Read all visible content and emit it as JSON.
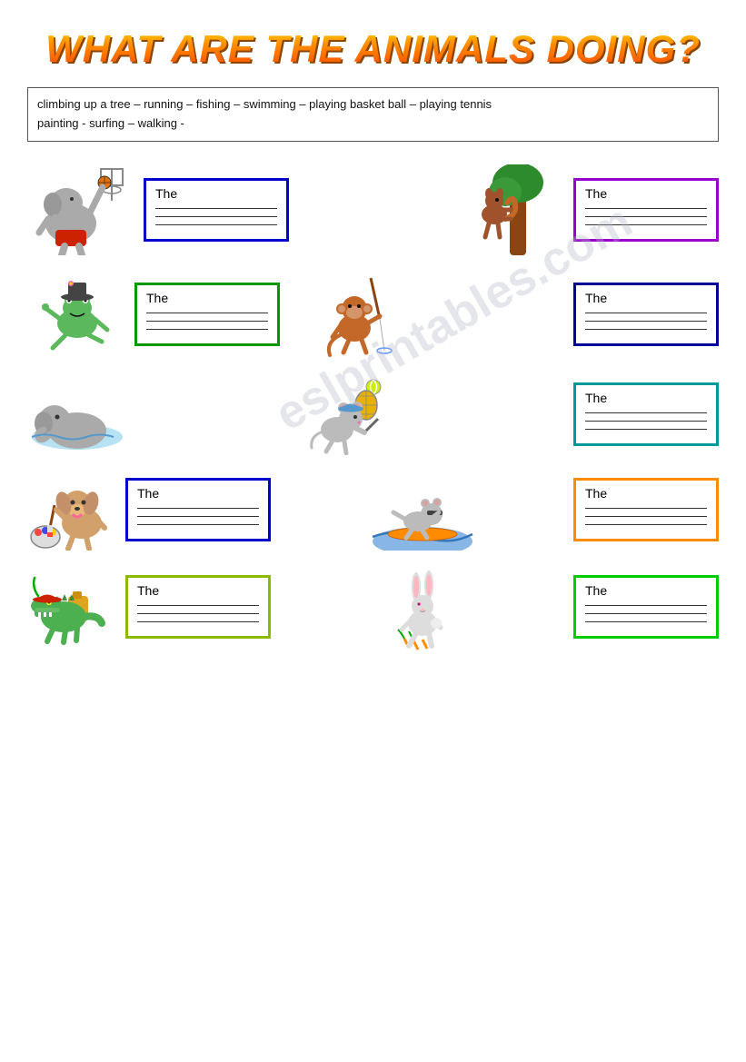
{
  "title": "WHAT ARE THE ANIMALS DOING?",
  "word_bank": {
    "line1": "climbing up a tree – running – fishing – swimming – playing basket ball – playing tennis",
    "line2": "painting -  surfing – walking -"
  },
  "watermark": "eslprintables.com",
  "the_label": "The",
  "exercises": [
    {
      "id": 1,
      "border_color": "blue",
      "position": "left-top",
      "animal": "elephant-basketball"
    },
    {
      "id": 2,
      "border_color": "purple",
      "position": "right-top",
      "animal": "squirrel-tree"
    },
    {
      "id": 3,
      "border_color": "dark-blue",
      "position": "right-mid1",
      "animal": "monkey-fishing"
    },
    {
      "id": 4,
      "border_color": "green",
      "position": "left-mid2",
      "animal": "frog-running"
    },
    {
      "id": 5,
      "border_color": "teal",
      "position": "right-mid2",
      "animal": "mouse-tennis"
    },
    {
      "id": 6,
      "border_color": "blue",
      "position": "left-mid3",
      "animal": "dog-painting"
    },
    {
      "id": 7,
      "border_color": "orange",
      "position": "right-mid3",
      "animal": "mouse-surfing"
    },
    {
      "id": 8,
      "border_color": "yellow-green",
      "position": "left-bot",
      "animal": "crocodile-walking"
    },
    {
      "id": 9,
      "border_color": "bright-green",
      "position": "right-bot",
      "animal": "rabbit-walking"
    }
  ],
  "animals": {
    "elephant-basketball": {
      "emoji": "🐘",
      "desc": "elephant playing basketball"
    },
    "squirrel-tree": {
      "emoji": "🐿️",
      "desc": "squirrel climbing tree"
    },
    "monkey-fishing": {
      "emoji": "🐒",
      "desc": "monkey fishing"
    },
    "frog-running": {
      "emoji": "🐸",
      "desc": "frog running"
    },
    "mouse-tennis": {
      "emoji": "🐭",
      "desc": "mouse playing tennis"
    },
    "dog-painting": {
      "emoji": "🐕",
      "desc": "dog painting"
    },
    "mouse-surfing": {
      "emoji": "🐀",
      "desc": "mouse surfing"
    },
    "crocodile-walking": {
      "emoji": "🐊",
      "desc": "crocodile walking"
    },
    "rabbit-walking": {
      "emoji": "🐇",
      "desc": "rabbit walking"
    }
  }
}
